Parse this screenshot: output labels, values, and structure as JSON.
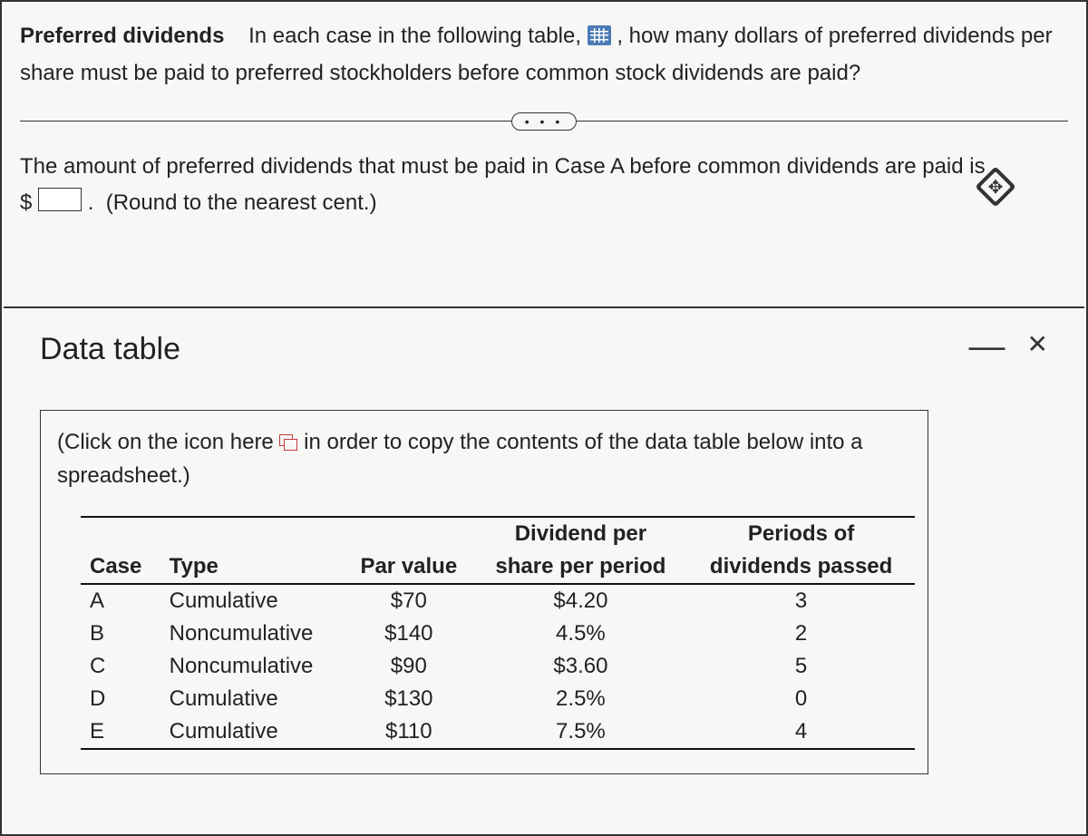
{
  "intro": {
    "title": "Preferred dividends",
    "before_icon": "In each case in the following table, ",
    "after_icon": " , how many dollars of preferred dividends per share must be paid to preferred stockholders before common stock dividends are paid?"
  },
  "question": {
    "line1_before": "The amount of preferred dividends that must be paid in Case A before common dividends are paid is",
    "currency": "$",
    "note": "(Round to the nearest cent.)"
  },
  "panel": {
    "title": "Data table",
    "instruction_before": "(Click on the icon here ",
    "instruction_after": " in order to copy the contents of the data table below into a spreadsheet.)",
    "headers": {
      "case": "Case",
      "type": "Type",
      "par": "Par value",
      "div_line1": "Dividend per",
      "div_line2": "share per period",
      "periods_line1": "Periods of",
      "periods_line2": "dividends passed"
    },
    "rows": [
      {
        "case": "A",
        "type": "Cumulative",
        "par": "$70",
        "div": "$4.20",
        "periods": "3"
      },
      {
        "case": "B",
        "type": "Noncumulative",
        "par": "$140",
        "div": "4.5%",
        "periods": "2"
      },
      {
        "case": "C",
        "type": "Noncumulative",
        "par": "$90",
        "div": "$3.60",
        "periods": "5"
      },
      {
        "case": "D",
        "type": "Cumulative",
        "par": "$130",
        "div": "2.5%",
        "periods": "0"
      },
      {
        "case": "E",
        "type": "Cumulative",
        "par": "$110",
        "div": "7.5%",
        "periods": "4"
      }
    ]
  },
  "icons": {
    "dots": "• • •"
  }
}
